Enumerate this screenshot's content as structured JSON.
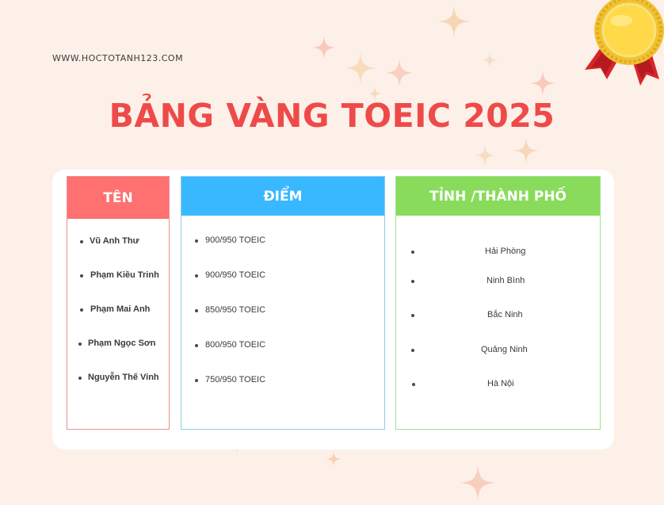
{
  "site": {
    "url": "WWW.HOCTOTANH123.COM"
  },
  "title": "BẢNG VÀNG TOEIC 2025",
  "columns": {
    "name": {
      "header": "TÊN"
    },
    "score": {
      "header": "ĐIỂM"
    },
    "city": {
      "header": "TỈNH /THÀNH PHỐ"
    }
  },
  "rows": [
    {
      "name": "Vũ Anh Thư",
      "score": "900/950 TOEIC",
      "city": "Hải Phòng"
    },
    {
      "name": "Phạm Kiều Trinh",
      "score": "900/950 TOEIC",
      "city": "Ninh Bình"
    },
    {
      "name": "Phạm Mai Anh",
      "score": "850/950 TOEIC",
      "city": "Bắc Ninh"
    },
    {
      "name": "Phạm Ngọc Sơn",
      "score": "800/950 TOEIC",
      "city": "Quảng Ninh"
    },
    {
      "name": "Nguyễn Thế Vinh",
      "score": "750/950 TOEIC",
      "city": "Hà Nội"
    }
  ],
  "colors": {
    "title": "#ee4a4a",
    "name_header": "#ff7070",
    "score_header": "#3ab8ff",
    "city_header": "#89db5c",
    "background": "#fdf0e8"
  },
  "icons": {
    "decor": "sparkle-icon",
    "badge": "medal-icon"
  }
}
